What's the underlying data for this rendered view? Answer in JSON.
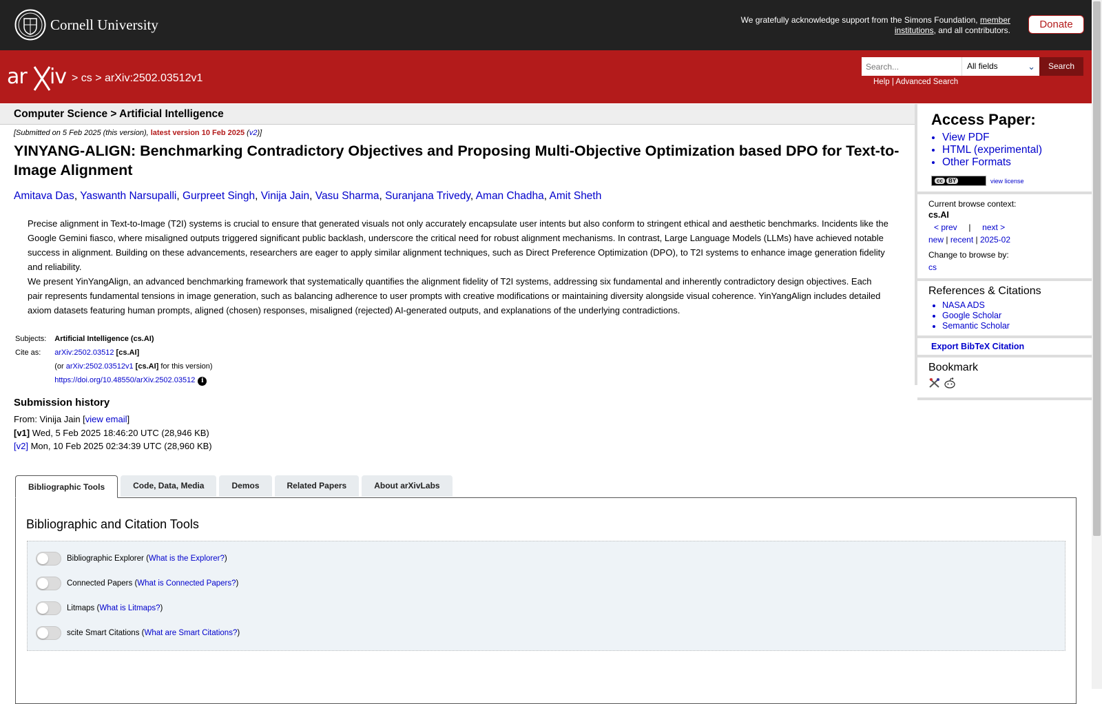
{
  "top": {
    "university": "Cornell University",
    "ack_text": "We gratefully acknowledge support from the Simons Foundation,",
    "ack_link": "member institutions",
    "ack_tail": ", and all contributors.",
    "donate": "Donate"
  },
  "header": {
    "crumb_cs": "cs",
    "crumb_id": "arXiv:2502.03512v1",
    "search_placeholder": "Search...",
    "field_select": "All fields",
    "search_button": "Search",
    "help": "Help",
    "advanced": "Advanced Search"
  },
  "subheader": "Computer Science > Artificial Intelligence",
  "dateline": {
    "submitted": "[Submitted on 5 Feb 2025 (this version), ",
    "latest": "latest version 10 Feb 2025",
    "v2": "v2",
    "open": " (",
    "close": ")]"
  },
  "paper": {
    "title": "YINYANG-ALIGN: Benchmarking Contradictory Objectives and Proposing Multi-Objective Optimization based DPO for Text-to-Image Alignment",
    "authors": [
      "Amitava Das",
      "Yaswanth Narsupalli",
      "Gurpreet Singh",
      "Vinija Jain",
      "Vasu Sharma",
      "Suranjana Trivedy",
      "Aman Chadha",
      "Amit Sheth"
    ],
    "abstract_p1": "Precise alignment in Text-to-Image (T2I) systems is crucial to ensure that generated visuals not only accurately encapsulate user intents but also conform to stringent ethical and aesthetic benchmarks. Incidents like the Google Gemini fiasco, where misaligned outputs triggered significant public backlash, underscore the critical need for robust alignment mechanisms. In contrast, Large Language Models (LLMs) have achieved notable success in alignment. Building on these advancements, researchers are eager to apply similar alignment techniques, such as Direct Preference Optimization (DPO), to T2I systems to enhance image generation fidelity and reliability.",
    "abstract_p2": "We present YinYangAlign, an advanced benchmarking framework that systematically quantifies the alignment fidelity of T2I systems, addressing six fundamental and inherently contradictory design objectives. Each pair represents fundamental tensions in image generation, such as balancing adherence to user prompts with creative modifications or maintaining diversity alongside visual coherence. YinYangAlign includes detailed axiom datasets featuring human prompts, aligned (chosen) responses, misaligned (rejected) AI-generated outputs, and explanations of the underlying contradictions."
  },
  "meta": {
    "subjects_label": "Subjects:",
    "subjects_value": "Artificial Intelligence (cs.AI)",
    "cite_label": "Cite as:",
    "cite_id": "arXiv:2502.03512",
    "cite_tag": "[cs.AI]",
    "or": "(or ",
    "cite_id_v": "arXiv:2502.03512v1",
    "cite_tag2": "[cs.AI]",
    "this_version": " for this version)",
    "doi": "https://doi.org/10.48550/arXiv.2502.03512"
  },
  "history": {
    "heading": "Submission history",
    "from": "From: Vinija Jain [",
    "view_email": "view email",
    "from_close": "]",
    "v1_label": "[v1]",
    "v1_text": " Wed, 5 Feb 2025 18:46:20 UTC (28,946 KB)",
    "v2_label": "[v2]",
    "v2_text": " Mon, 10 Feb 2025 02:34:39 UTC (28,960 KB)"
  },
  "sidebar": {
    "access_heading": "Access Paper:",
    "access_links": [
      "View PDF",
      "HTML (experimental)",
      "Other Formats"
    ],
    "cc_label": "BY",
    "view_license": "view license",
    "context_label": "Current browse context:",
    "context_value": "cs.AI",
    "prev": "< prev",
    "sep": "|",
    "next": "next >",
    "new": "new",
    "recent": "recent",
    "month": "2025-02",
    "change_label": "Change to browse by:",
    "change_value": "cs",
    "refs_heading": "References & Citations",
    "refs": [
      "NASA ADS",
      "Google Scholar",
      "Semantic Scholar"
    ],
    "bibtex": "Export BibTeX Citation",
    "bookmark": "Bookmark"
  },
  "tabs": [
    "Bibliographic Tools",
    "Code, Data, Media",
    "Demos",
    "Related Papers",
    "About arXivLabs"
  ],
  "panel": {
    "heading": "Bibliographic and Citation Tools",
    "tools": [
      {
        "name": "Bibliographic Explorer",
        "link": "What is the Explorer?"
      },
      {
        "name": "Connected Papers",
        "link": "What is Connected Papers?"
      },
      {
        "name": "Litmaps",
        "link": "What is Litmaps?"
      },
      {
        "name": "scite Smart Citations",
        "link": "What are Smart Citations?"
      }
    ]
  },
  "colors": {
    "brand_red": "#b31b1b",
    "topbar": "#222222",
    "link": "#0000cc"
  }
}
